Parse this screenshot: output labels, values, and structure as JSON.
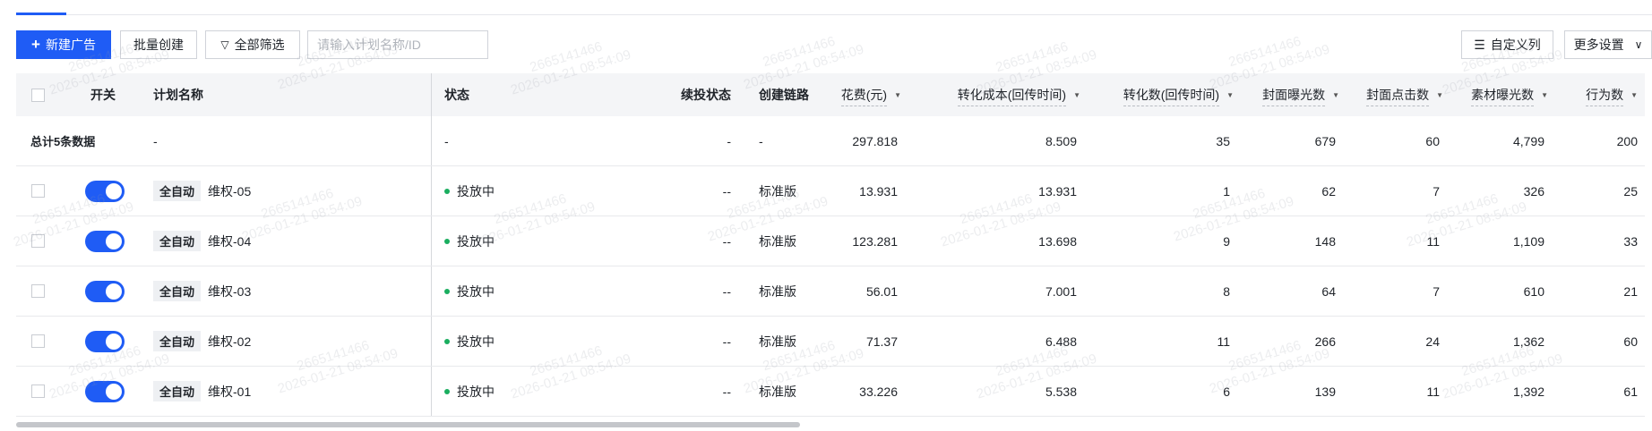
{
  "toolbar": {
    "new_ad": "新建广告",
    "batch_create": "批量创建",
    "filter_all": "全部筛选",
    "search_placeholder": "请输入计划名称/ID",
    "custom_columns": "自定义列",
    "more_settings": "更多设置"
  },
  "watermark": {
    "id": "2665141466",
    "time": "2026-01-21 08:54:09"
  },
  "columns": {
    "switch": "开关",
    "name": "计划名称",
    "status": "状态",
    "renew_status": "续投状态",
    "create_link": "创建链路",
    "cost": "花费(元)",
    "conv_cost": "转化成本(回传时间)",
    "conv_count": "转化数(回传时间)",
    "cover_impr": "封面曝光数",
    "cover_click": "封面点击数",
    "material_impr": "素材曝光数",
    "actions": "行为数"
  },
  "total": {
    "label": "总计5条数据",
    "name": "-",
    "status": "-",
    "renew_status": "-",
    "create_link": "-",
    "cost": "297.818",
    "conv_cost": "8.509",
    "conv_count": "35",
    "cover_impr": "679",
    "cover_click": "60",
    "material_impr": "4,799",
    "actions": "200"
  },
  "rows": [
    {
      "tag": "全自动",
      "name": "维权-05",
      "status": "投放中",
      "renew_status": "--",
      "create_link": "标准版",
      "cost": "13.931",
      "conv_cost": "13.931",
      "conv_count": "1",
      "cover_impr": "62",
      "cover_click": "7",
      "material_impr": "326",
      "actions": "25",
      "enabled": true
    },
    {
      "tag": "全自动",
      "name": "维权-04",
      "status": "投放中",
      "renew_status": "--",
      "create_link": "标准版",
      "cost": "123.281",
      "conv_cost": "13.698",
      "conv_count": "9",
      "cover_impr": "148",
      "cover_click": "11",
      "material_impr": "1,109",
      "actions": "33",
      "enabled": true
    },
    {
      "tag": "全自动",
      "name": "维权-03",
      "status": "投放中",
      "renew_status": "--",
      "create_link": "标准版",
      "cost": "56.01",
      "conv_cost": "7.001",
      "conv_count": "8",
      "cover_impr": "64",
      "cover_click": "7",
      "material_impr": "610",
      "actions": "21",
      "enabled": true
    },
    {
      "tag": "全自动",
      "name": "维权-02",
      "status": "投放中",
      "renew_status": "--",
      "create_link": "标准版",
      "cost": "71.37",
      "conv_cost": "6.488",
      "conv_count": "11",
      "cover_impr": "266",
      "cover_click": "24",
      "material_impr": "1,362",
      "actions": "60",
      "enabled": true
    },
    {
      "tag": "全自动",
      "name": "维权-01",
      "status": "投放中",
      "renew_status": "--",
      "create_link": "标准版",
      "cost": "33.226",
      "conv_cost": "5.538",
      "conv_count": "6",
      "cover_impr": "139",
      "cover_click": "11",
      "material_impr": "1,392",
      "actions": "61",
      "enabled": true
    }
  ],
  "colors": {
    "accent": "#1f5cf5",
    "status_running": "#1aae5f"
  }
}
